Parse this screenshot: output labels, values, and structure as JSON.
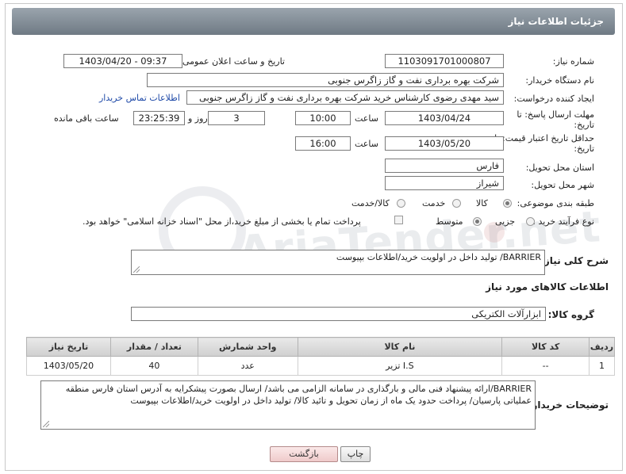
{
  "header": {
    "title": "جزئیات اطلاعات نیاز"
  },
  "fields": {
    "need_number_label": "شماره نیاز:",
    "need_number": "1103091701000807",
    "announce_label": "تاریخ و ساعت اعلان عمومی:",
    "announce_value": "1403/04/20 - 09:37",
    "buyer_org_label": "نام دستگاه خریدار:",
    "buyer_org": "شرکت بهره برداری نفت و گاز زاگرس جنوبی",
    "creator_label": "ایجاد کننده درخواست:",
    "creator": "سید مهدی رضوی کارشناس خرید شرکت بهره برداری نفت و گاز زاگرس جنوبی",
    "contact_link": "اطلاعات تماس خریدار",
    "deadline_label_1": "مهلت ارسال پاسخ: تا",
    "deadline_label_2": "تاریخ:",
    "deadline_date": "1403/04/24",
    "time_label": "ساعت",
    "deadline_time": "10:00",
    "days_value": "3",
    "days_label": "روز و",
    "remaining_value": "23:25:39",
    "remaining_label": "ساعت باقی مانده",
    "validity_label_1": "حداقل تاریخ اعتبار قیمت: تا",
    "validity_label_2": "تاریخ:",
    "validity_date": "1403/05/20",
    "validity_time_label": "ساعت",
    "validity_time": "16:00",
    "province_label": "استان محل تحویل:",
    "province": "فارس",
    "city_label": "شهر محل تحویل:",
    "city": "شیراز",
    "category_label": "طبقه بندی موضوعی:",
    "category_options": [
      "کالا",
      "خدمت",
      "کالا/خدمت"
    ],
    "purchase_label": "نوع فرآیند خرید :",
    "purchase_options": [
      "جزیی",
      "متوسط"
    ],
    "purchase_note": "پرداخت تمام یا بخشی از مبلغ خرید،از محل \"اسناد خزانه اسلامی\" خواهد بود.",
    "description_label": "شرح کلی نیاز:",
    "description": "BARRIER/ تولید داخل در اولویت خرید/اطلاعات بپیوست",
    "goods_info_title": "اطلاعات کالاهای مورد نیاز",
    "goods_group_label": "گروه کالا:",
    "goods_group": "ابزارآلات الکتریکی"
  },
  "table": {
    "headers": [
      "ردیف",
      "کد کالا",
      "نام کالا",
      "واحد شمارش",
      "تعداد / مقدار",
      "تاریخ نیاز"
    ],
    "rows": [
      [
        "1",
        "--",
        "I.S تزیر",
        "عدد",
        "40",
        "1403/05/20"
      ]
    ]
  },
  "buyer_notes_label": "توضیحات خریدار:",
  "buyer_notes": "BARRIER/ارائه پیشنهاد فنی مالی و بارگذاری در سامانه الزامی می باشد/ ارسال بصورت پیشکرایه به آدرس استان فارس منطقه عملیاتی پارسیان/ پرداخت حدود یک ماه از زمان تحویل و تائید کالا/ تولید داخل در اولویت خرید/اطلاعات بپیوست",
  "buttons": {
    "print": "چاپ",
    "back": "بازگشت"
  },
  "watermark": "AriaTender.net"
}
